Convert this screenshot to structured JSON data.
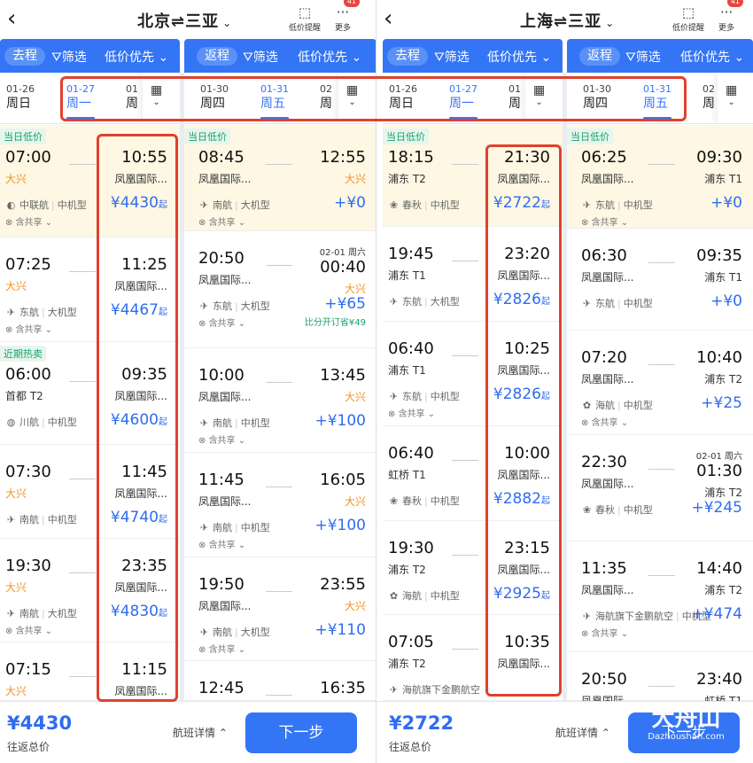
{
  "left": {
    "title": "北京⇌三亚",
    "price_alert": "低价提醒",
    "more": "更多",
    "badge": "41",
    "tabs_go": {
      "pill": "去程",
      "filter": "筛选",
      "sort": "低价优先"
    },
    "tabs_ret": {
      "pill": "返程",
      "filter": "筛选",
      "sort": "低价优先"
    },
    "go_dates": [
      {
        "date": "01-26",
        "wd": "周日"
      },
      {
        "date": "01-27",
        "wd": "周一"
      },
      {
        "date": "01",
        "wd": "周"
      }
    ],
    "ret_dates": [
      {
        "date": "01-30",
        "wd": "周四"
      },
      {
        "date": "01-31",
        "wd": "周五"
      },
      {
        "date": "02",
        "wd": "周"
      }
    ],
    "go_flights": [
      {
        "tag": "当日低价",
        "dep": "07:00",
        "depA": "大兴",
        "arr": "10:55",
        "arrA": "凤凰国际...",
        "logo": "◐",
        "air": "中联航",
        "type": "中机型",
        "share": "含共享",
        "price": "¥4430",
        "qi": "起"
      },
      {
        "tag": "",
        "dep": "07:25",
        "depA": "大兴",
        "arr": "11:25",
        "arrA": "凤凰国际...",
        "logo": "✈",
        "air": "东航",
        "type": "大机型",
        "share": "含共享",
        "price": "¥4467",
        "qi": "起"
      },
      {
        "tag": "近期热卖",
        "dep": "06:00",
        "depA": "首都 T2",
        "arr": "09:35",
        "arrA": "凤凰国际...",
        "logo": "◍",
        "air": "川航",
        "type": "中机型",
        "share": "",
        "price": "¥4600",
        "qi": "起"
      },
      {
        "tag": "",
        "dep": "07:30",
        "depA": "大兴",
        "arr": "11:45",
        "arrA": "凤凰国际...",
        "logo": "✈",
        "air": "南航",
        "type": "中机型",
        "share": "",
        "price": "¥4740",
        "qi": "起"
      },
      {
        "tag": "",
        "dep": "19:30",
        "depA": "大兴",
        "arr": "23:35",
        "arrA": "凤凰国际...",
        "logo": "✈",
        "air": "南航",
        "type": "大机型",
        "share": "含共享",
        "price": "¥4830",
        "qi": "起"
      },
      {
        "tag": "",
        "dep": "07:15",
        "depA": "大兴",
        "arr": "11:15",
        "arrA": "凤凰国际...",
        "logo": "",
        "air": "",
        "type": "",
        "share": "",
        "price": "",
        "qi": ""
      }
    ],
    "ret_flights": [
      {
        "tag": "当日低价",
        "dep": "08:45",
        "depA": "凤凰国际...",
        "arr": "12:55",
        "arrA": "大兴",
        "nextday": "",
        "logo": "✈",
        "air": "南航",
        "type": "大机型",
        "share": "含共享",
        "price": "+¥0",
        "save": ""
      },
      {
        "tag": "",
        "dep": "20:50",
        "depA": "凤凰国际...",
        "arr": "00:40",
        "arrA": "大兴",
        "nextday": "02-01 周六",
        "logo": "✈",
        "air": "东航",
        "type": "大机型",
        "share": "含共享",
        "price": "+¥65",
        "save": "比分开订省¥49"
      },
      {
        "tag": "",
        "dep": "10:00",
        "depA": "凤凰国际...",
        "arr": "13:45",
        "arrA": "大兴",
        "nextday": "",
        "logo": "✈",
        "air": "南航",
        "type": "中机型",
        "share": "含共享",
        "price": "+¥100",
        "save": ""
      },
      {
        "tag": "",
        "dep": "11:45",
        "depA": "凤凰国际...",
        "arr": "16:05",
        "arrA": "大兴",
        "nextday": "",
        "logo": "✈",
        "air": "南航",
        "type": "中机型",
        "share": "含共享",
        "price": "+¥100",
        "save": ""
      },
      {
        "tag": "",
        "dep": "19:50",
        "depA": "凤凰国际...",
        "arr": "23:55",
        "arrA": "大兴",
        "nextday": "",
        "logo": "✈",
        "air": "南航",
        "type": "大机型",
        "share": "含共享",
        "price": "+¥110",
        "save": ""
      },
      {
        "tag": "",
        "dep": "12:45",
        "depA": "",
        "arr": "16:35",
        "arrA": "",
        "nextday": "",
        "logo": "",
        "air": "",
        "type": "",
        "share": "",
        "price": "",
        "save": ""
      }
    ],
    "total": "¥4430",
    "total_label": "往返总价",
    "detail": "航班详情",
    "next": "下一步"
  },
  "right": {
    "title": "上海⇌三亚",
    "price_alert": "低价提醒",
    "more": "更多",
    "badge": "41",
    "tabs_go": {
      "pill": "去程",
      "filter": "筛选",
      "sort": "低价优先"
    },
    "tabs_ret": {
      "pill": "返程",
      "filter": "筛选",
      "sort": "低价优先"
    },
    "go_dates": [
      {
        "date": "01-26",
        "wd": "周日"
      },
      {
        "date": "01-27",
        "wd": "周一"
      },
      {
        "date": "01",
        "wd": "周"
      }
    ],
    "ret_dates": [
      {
        "date": "01-30",
        "wd": "周四"
      },
      {
        "date": "01-31",
        "wd": "周五"
      },
      {
        "date": "02",
        "wd": "周"
      }
    ],
    "go_flights": [
      {
        "tag": "当日低价",
        "dep": "18:15",
        "depA": "浦东 T2",
        "arr": "21:30",
        "arrA": "凤凰国际...",
        "logo": "❀",
        "air": "春秋",
        "type": "中机型",
        "share": "",
        "price": "¥2722",
        "qi": "起"
      },
      {
        "tag": "",
        "dep": "19:45",
        "depA": "浦东 T1",
        "arr": "23:20",
        "arrA": "凤凰国际...",
        "logo": "✈",
        "air": "东航",
        "type": "大机型",
        "share": "",
        "price": "¥2826",
        "qi": "起"
      },
      {
        "tag": "",
        "dep": "06:40",
        "depA": "浦东 T1",
        "arr": "10:25",
        "arrA": "凤凰国际...",
        "logo": "✈",
        "air": "东航",
        "type": "中机型",
        "share": "含共享",
        "price": "¥2826",
        "qi": "起"
      },
      {
        "tag": "",
        "dep": "06:40",
        "depA": "虹桥 T1",
        "arr": "10:00",
        "arrA": "凤凰国际...",
        "logo": "❀",
        "air": "春秋",
        "type": "中机型",
        "share": "",
        "price": "¥2882",
        "qi": "起"
      },
      {
        "tag": "",
        "dep": "19:30",
        "depA": "浦东 T2",
        "arr": "23:15",
        "arrA": "凤凰国际...",
        "logo": "✿",
        "air": "海航",
        "type": "中机型",
        "share": "",
        "price": "¥2925",
        "qi": "起"
      },
      {
        "tag": "",
        "dep": "07:05",
        "depA": "浦东 T2",
        "arr": "10:35",
        "arrA": "凤凰国际...",
        "logo": "✈",
        "air": "海航旗下金鹏航空",
        "type": "",
        "share": "",
        "price": "",
        "qi": ""
      }
    ],
    "ret_flights": [
      {
        "tag": "当日低价",
        "dep": "06:25",
        "depA": "凤凰国际...",
        "arr": "09:30",
        "arrA": "浦东 T1",
        "nextday": "",
        "logo": "✈",
        "air": "东航",
        "type": "中机型",
        "share": "含共享",
        "price": "+¥0",
        "save": ""
      },
      {
        "tag": "",
        "dep": "06:30",
        "depA": "凤凰国际...",
        "arr": "09:35",
        "arrA": "浦东 T1",
        "nextday": "",
        "logo": "✈",
        "air": "东航",
        "type": "中机型",
        "share": "",
        "price": "+¥0",
        "save": ""
      },
      {
        "tag": "",
        "dep": "07:20",
        "depA": "凤凰国际...",
        "arr": "10:40",
        "arrA": "浦东 T2",
        "nextday": "",
        "logo": "✿",
        "air": "海航",
        "type": "中机型",
        "share": "含共享",
        "price": "+¥25",
        "save": ""
      },
      {
        "tag": "",
        "dep": "22:30",
        "depA": "凤凰国际...",
        "arr": "01:30",
        "arrA": "浦东 T2",
        "nextday": "02-01 周六",
        "logo": "❀",
        "air": "春秋",
        "type": "中机型",
        "share": "",
        "price": "+¥245",
        "save": ""
      },
      {
        "tag": "",
        "dep": "11:35",
        "depA": "凤凰国际...",
        "arr": "14:40",
        "arrA": "浦东 T2",
        "nextday": "",
        "logo": "✈",
        "air": "海航旗下金鹏航空",
        "type": "中机型",
        "share": "含共享",
        "price": "+¥474",
        "save": ""
      },
      {
        "tag": "",
        "dep": "20:50",
        "depA": "凤凰国际...",
        "arr": "23:40",
        "arrA": "虹桥 T1",
        "nextday": "",
        "logo": "",
        "air": "",
        "type": "",
        "share": "",
        "price": "",
        "save": ""
      }
    ],
    "total": "¥2722",
    "total_label": "往返总价",
    "detail": "航班详情",
    "next": "下一步"
  },
  "watermark": {
    "brand": "大舟山",
    "site": "Dazhoushan.com"
  }
}
